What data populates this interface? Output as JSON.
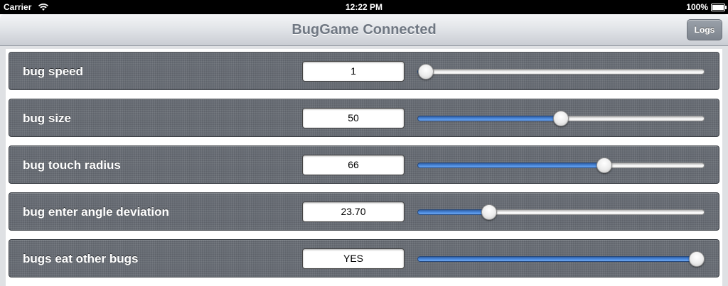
{
  "status_bar": {
    "carrier": "Carrier",
    "wifi_icon": "wifi-icon",
    "time": "12:22 PM",
    "battery_percent": "100%",
    "battery_icon": "battery-icon"
  },
  "nav_bar": {
    "title": "BugGame Connected",
    "logs_label": "Logs"
  },
  "settings": [
    {
      "id": "bug-speed",
      "label": "bug speed",
      "value": "1",
      "slider_fraction": 0.03
    },
    {
      "id": "bug-size",
      "label": "bug size",
      "value": "50",
      "slider_fraction": 0.5
    },
    {
      "id": "bug-touch-radius",
      "label": "bug touch radius",
      "value": "66",
      "slider_fraction": 0.65
    },
    {
      "id": "bug-enter-angle-deviation",
      "label": "bug enter angle deviation",
      "value": "23.70",
      "slider_fraction": 0.25
    },
    {
      "id": "bugs-eat-other-bugs",
      "label": "bugs eat other bugs",
      "value": "YES",
      "slider_fraction": 0.98
    }
  ],
  "colors": {
    "slider_fill": "#3f7fd6",
    "row_background": "#676c74",
    "nav_title": "#6f7782"
  }
}
